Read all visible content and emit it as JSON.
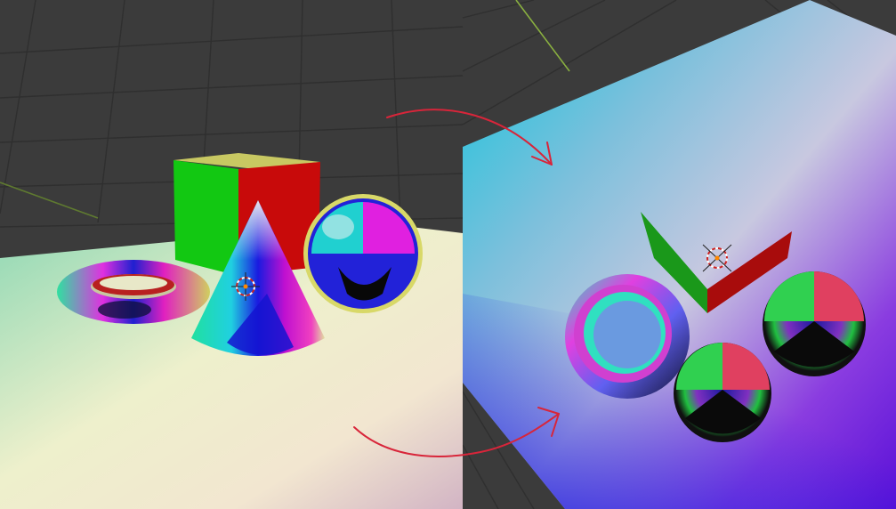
{
  "viewport": {
    "background": "#3a3a3a",
    "grid_color": "#303030",
    "axis_x_color": "#7a9a3a",
    "axis_y_color": "#8ab040"
  },
  "left_view": {
    "shading": "normal-map-world",
    "plane_colors": [
      "#8fdcc0",
      "#e8ecc8",
      "#f3ead2",
      "#d9b8c0"
    ],
    "objects": [
      {
        "kind": "cube",
        "front_color": "#12cc12",
        "side_color": "#cc0a0a",
        "top_color": "#cfd060"
      },
      {
        "kind": "cone"
      },
      {
        "kind": "sphere"
      },
      {
        "kind": "torus"
      }
    ],
    "cursor_icon": "3d-cursor-icon"
  },
  "right_view": {
    "shading": "normal-map-tangent",
    "plane_colors": [
      "#16c8dc",
      "#b8c4d8",
      "#7a1ae0",
      "#3018d8"
    ],
    "objects": [
      {
        "kind": "cube-edge",
        "front_color": "#1a9a1a",
        "side_color": "#a80c0c"
      },
      {
        "kind": "torus"
      },
      {
        "kind": "sphere"
      },
      {
        "kind": "sphere"
      }
    ],
    "cursor_icon": "3d-cursor-icon"
  },
  "annotations": {
    "arrow_color": "#d8253a",
    "arrows": [
      "top-arrow",
      "bottom-arrow"
    ]
  }
}
